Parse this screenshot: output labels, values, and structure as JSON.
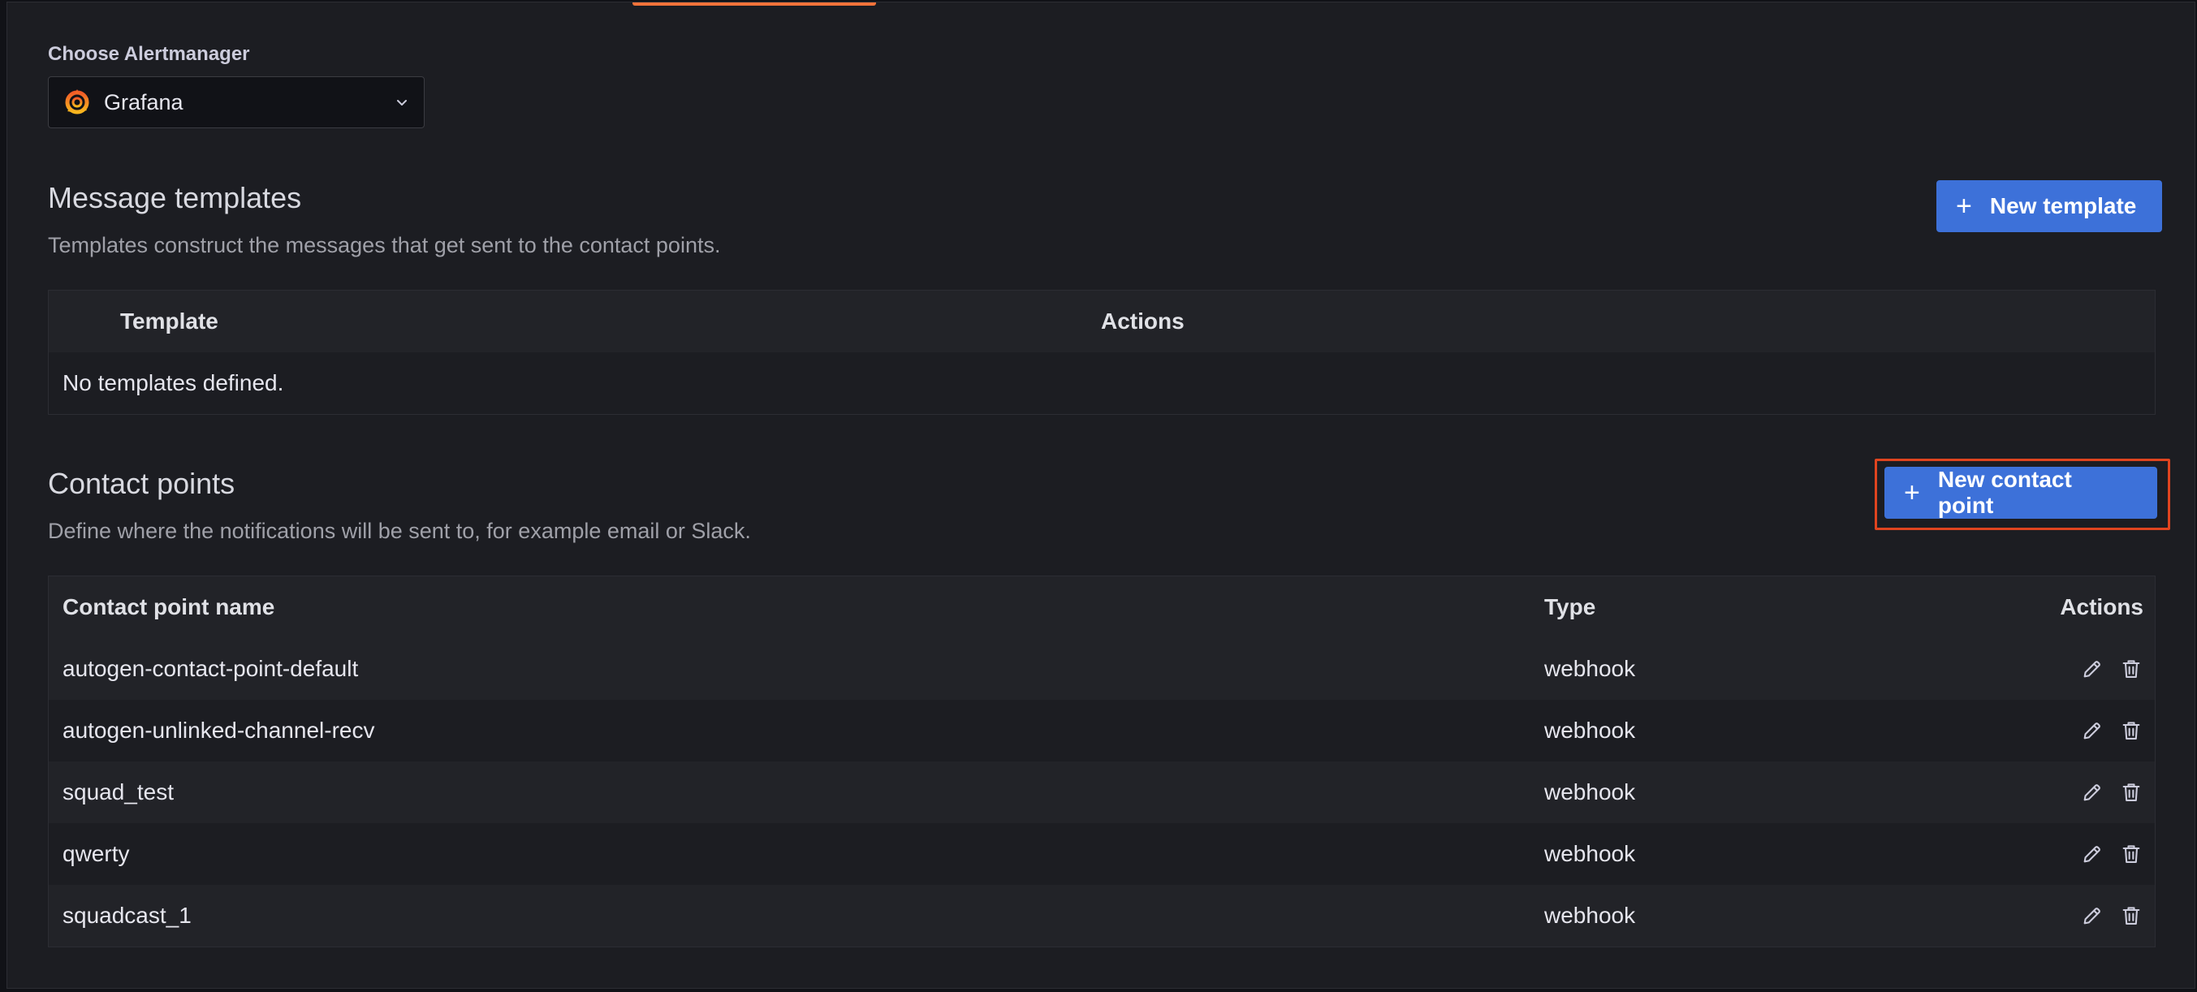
{
  "alertmanager": {
    "label": "Choose Alertmanager",
    "selected": "Grafana",
    "logo_icon": "grafana-logo-icon"
  },
  "templates_section": {
    "title": "Message templates",
    "description": "Templates construct the messages that get sent to the contact points.",
    "new_button": "New template",
    "columns": [
      "Template",
      "Actions"
    ],
    "empty_text": "No templates defined."
  },
  "contacts_section": {
    "title": "Contact points",
    "description": "Define where the notifications will be sent to, for example email or Slack.",
    "new_button": "New contact point",
    "columns": [
      "Contact point name",
      "Type",
      "Actions"
    ],
    "rows": [
      {
        "name": "autogen-contact-point-default",
        "type": "webhook"
      },
      {
        "name": "autogen-unlinked-channel-recv",
        "type": "webhook"
      },
      {
        "name": "squad_test",
        "type": "webhook"
      },
      {
        "name": "qwerty",
        "type": "webhook"
      },
      {
        "name": "squadcast_1",
        "type": "webhook"
      }
    ]
  },
  "colors": {
    "accent": "#3d71d9",
    "highlight": "#e0441f",
    "tab_indicator": "#f2733a"
  }
}
